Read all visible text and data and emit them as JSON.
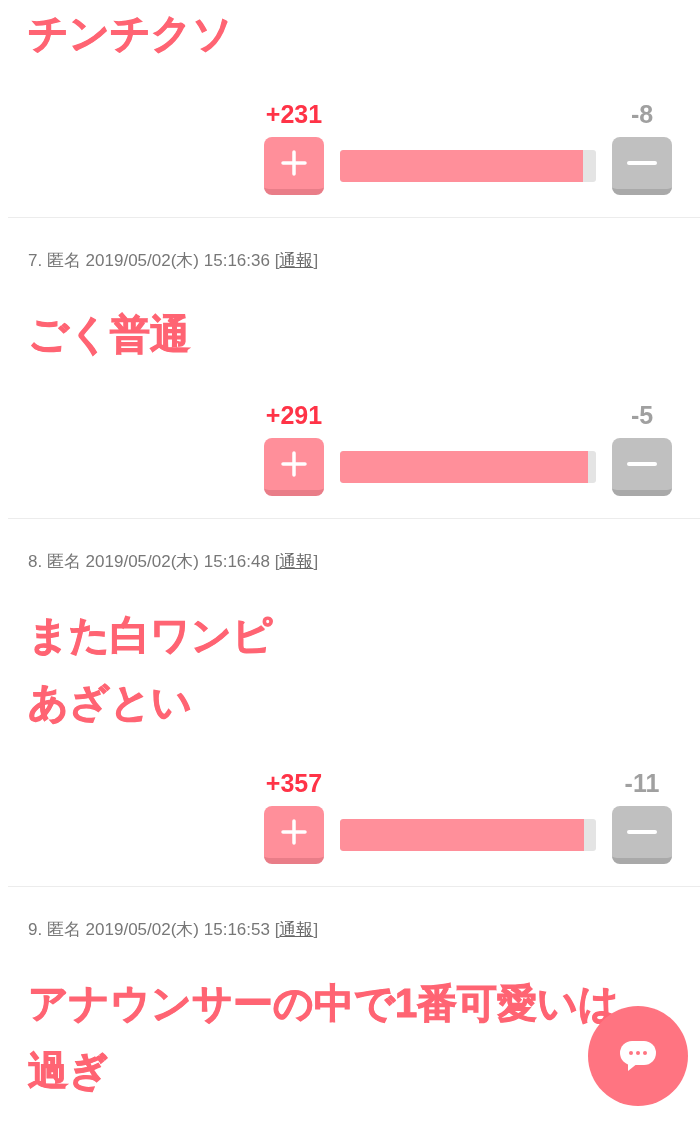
{
  "comments": [
    {
      "lines": [
        "チンチクソ"
      ],
      "votes": {
        "plus": "+231",
        "minus": "-8",
        "level": 0.95
      }
    },
    {
      "meta": "7. 匿名 2019/05/02(木) 15:16:36 [",
      "report_link": "通報",
      "meta_close": "]",
      "lines": [
        "ごく普通"
      ],
      "votes": {
        "plus": "+291",
        "minus": "-5",
        "level": 0.97
      }
    },
    {
      "meta": "8. 匿名 2019/05/02(木) 15:16:48 [",
      "report_link": "通報",
      "meta_close": "]",
      "lines": [
        "また白ワンピ",
        "あざとい"
      ],
      "votes": {
        "plus": "+357",
        "minus": "-11",
        "level": 0.955
      }
    },
    {
      "meta": "9. 匿名 2019/05/02(木) 15:16:53 [",
      "report_link": "通報",
      "meta_close": "]",
      "lines": [
        "アナウンサーの中で1番可愛いは",
        "過ぎ"
      ]
    }
  ]
}
